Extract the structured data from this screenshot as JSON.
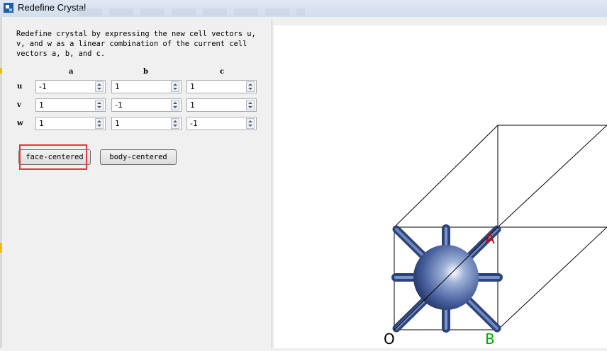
{
  "window": {
    "title": "Redefine Crystal"
  },
  "instructions": "Redefine crystal by expressing the new  cell vectors u,\nv, and w as a linear combination of the current cell\nvectors a, b, and c.",
  "columns": [
    "a",
    "b",
    "c"
  ],
  "rows": [
    {
      "label": "u",
      "values": [
        "-1",
        "1",
        "1"
      ]
    },
    {
      "label": "v",
      "values": [
        "1",
        "-1",
        "1"
      ]
    },
    {
      "label": "w",
      "values": [
        "1",
        "1",
        "-1"
      ]
    }
  ],
  "buttons": {
    "face_centered": "face-centered",
    "body_centered": "body-centered"
  },
  "viewer": {
    "axis_labels": {
      "origin": "O",
      "a": "A",
      "b": "B"
    },
    "colors": {
      "origin": "#000000",
      "a": "#cc0000",
      "b": "#00aa00",
      "atom": "#4a62a0"
    }
  }
}
